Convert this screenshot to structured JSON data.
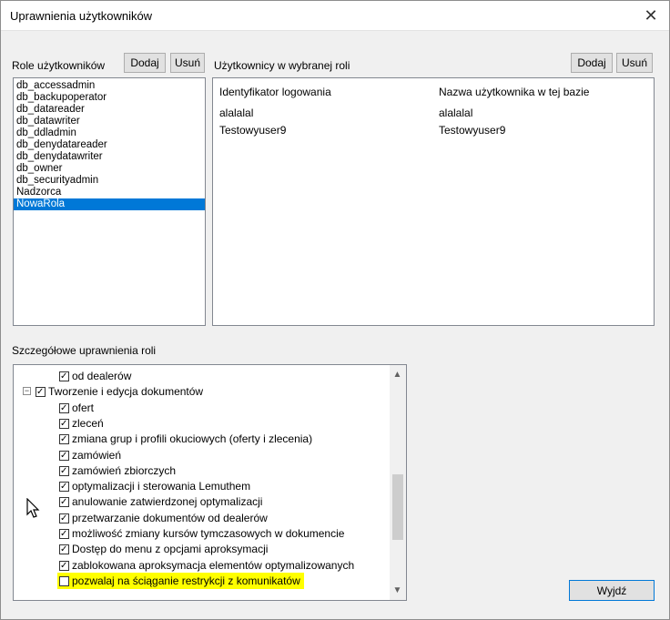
{
  "window": {
    "title": "Uprawnienia użytkowników",
    "close_glyph": "✕"
  },
  "roles": {
    "label": "Role użytkowników",
    "add_label": "Dodaj",
    "remove_label": "Usuń",
    "items": [
      "db_accessadmin",
      "db_backupoperator",
      "db_datareader",
      "db_datawriter",
      "db_ddladmin",
      "db_denydatareader",
      "db_denydatawriter",
      "db_owner",
      "db_securityadmin",
      "Nadzorca",
      "NowaRola"
    ],
    "selected": "NowaRola"
  },
  "users": {
    "label": "Użytkownicy w wybranej roli",
    "add_label": "Dodaj",
    "remove_label": "Usuń",
    "columns": [
      "Identyfikator logowania",
      "Nazwa użytkownika w tej bazie"
    ],
    "rows": [
      [
        "alalalal",
        "alalalal"
      ],
      [
        "Testowyuser9",
        "Testowyuser9"
      ]
    ]
  },
  "permissions": {
    "label": "Szczegółowe uprawnienia roli",
    "tree": [
      {
        "text": "od dealerów",
        "checked": true,
        "level": 2
      },
      {
        "text": "Tworzenie i edycja dokumentów",
        "checked": true,
        "level": 1,
        "expander": "−"
      },
      {
        "text": "ofert",
        "checked": true,
        "level": 2
      },
      {
        "text": "zleceń",
        "checked": true,
        "level": 2
      },
      {
        "text": "zmiana grup i profili okuciowych (oferty i zlecenia)",
        "checked": true,
        "level": 2
      },
      {
        "text": "zamówień",
        "checked": true,
        "level": 2
      },
      {
        "text": "zamówień zbiorczych",
        "checked": true,
        "level": 2
      },
      {
        "text": "optymalizacji i sterowania Lemuthem",
        "checked": true,
        "level": 2
      },
      {
        "text": "anulowanie zatwierdzonej optymalizacji",
        "checked": true,
        "level": 2
      },
      {
        "text": "przetwarzanie dokumentów od dealerów",
        "checked": true,
        "level": 2
      },
      {
        "text": "możliwość zmiany kursów tymczasowych w dokumencie",
        "checked": true,
        "level": 2
      },
      {
        "text": "Dostęp do menu z opcjami aproksymacji",
        "checked": true,
        "level": 2
      },
      {
        "text": "zablokowana aproksymacja elementów optymalizowanych",
        "checked": true,
        "level": 2
      },
      {
        "text": "pozwalaj na ściąganie restrykcji z komunikatów",
        "checked": false,
        "level": 2,
        "highlight": true
      }
    ],
    "scroll_up": "▲",
    "scroll_down": "▼"
  },
  "exit_label": "Wyjdź",
  "colors": {
    "selection": "#0078d7",
    "highlight": "#ffff00"
  }
}
